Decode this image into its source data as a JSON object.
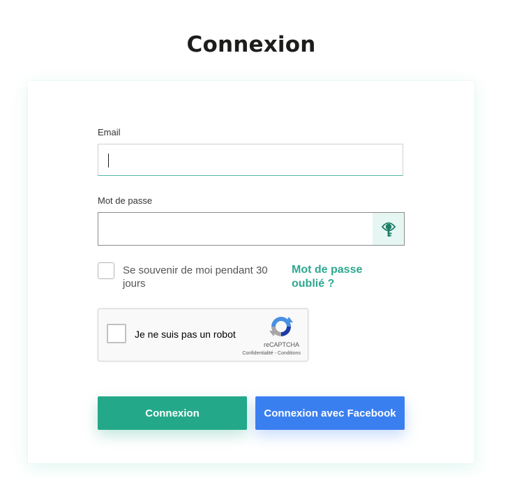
{
  "page": {
    "title": "Connexion"
  },
  "form": {
    "email_label": "Email",
    "email_value": "",
    "password_label": "Mot de passe",
    "password_value": "",
    "show_password_icon": "key-eye-icon",
    "remember_label": "Se souvenir de moi pendant 30 jours",
    "remember_checked": false,
    "forgot_link": "Mot de passe oublié ?"
  },
  "captcha": {
    "label": "Je ne suis pas un robot",
    "brand": "reCAPTCHA",
    "links": "Confidentialité - Conditions",
    "checked": false
  },
  "buttons": {
    "login": "Connexion",
    "facebook": "Connexion avec Facebook"
  },
  "colors": {
    "accent": "#23a98a",
    "link": "#2ea88f",
    "facebook": "#3a7ff0"
  }
}
